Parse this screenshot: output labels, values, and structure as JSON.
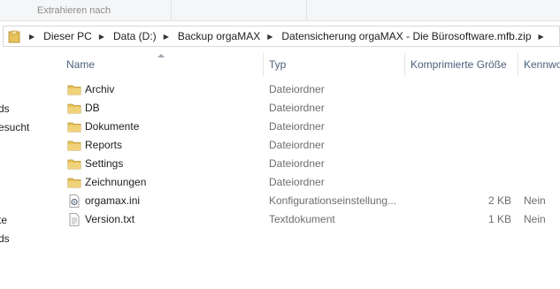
{
  "ribbon": {
    "extract_label": "Extrahieren nach"
  },
  "address": {
    "crumbs": [
      "Dieser PC",
      "Data (D:)",
      "Backup orgaMAX",
      "Datensicherung orgaMAX - Die Bürosoftware.mfb.zip"
    ]
  },
  "nav": {
    "items": [
      "ds",
      "esucht",
      "te",
      "ds"
    ]
  },
  "columns": {
    "name": "Name",
    "type": "Typ",
    "size": "Komprimierte Größe",
    "protected": "Kennwo"
  },
  "files": [
    {
      "name": "Archiv",
      "type": "Dateiordner",
      "size": "",
      "protected": "",
      "icon": "folder-icon"
    },
    {
      "name": "DB",
      "type": "Dateiordner",
      "size": "",
      "protected": "",
      "icon": "folder-icon"
    },
    {
      "name": "Dokumente",
      "type": "Dateiordner",
      "size": "",
      "protected": "",
      "icon": "folder-icon"
    },
    {
      "name": "Reports",
      "type": "Dateiordner",
      "size": "",
      "protected": "",
      "icon": "folder-icon"
    },
    {
      "name": "Settings",
      "type": "Dateiordner",
      "size": "",
      "protected": "",
      "icon": "folder-icon"
    },
    {
      "name": "Zeichnungen",
      "type": "Dateiordner",
      "size": "",
      "protected": "",
      "icon": "folder-icon"
    },
    {
      "name": "orgamax.ini",
      "type": "Konfigurationseinstellung...",
      "size": "2 KB",
      "protected": "Nein",
      "icon": "settings-file-icon"
    },
    {
      "name": "Version.txt",
      "type": "Textdokument",
      "size": "1 KB",
      "protected": "Nein",
      "icon": "text-file-icon"
    }
  ],
  "colors": {
    "folder": "#e8c25a",
    "header_text": "#4c607a",
    "secondary_text": "#6d6d6d"
  }
}
